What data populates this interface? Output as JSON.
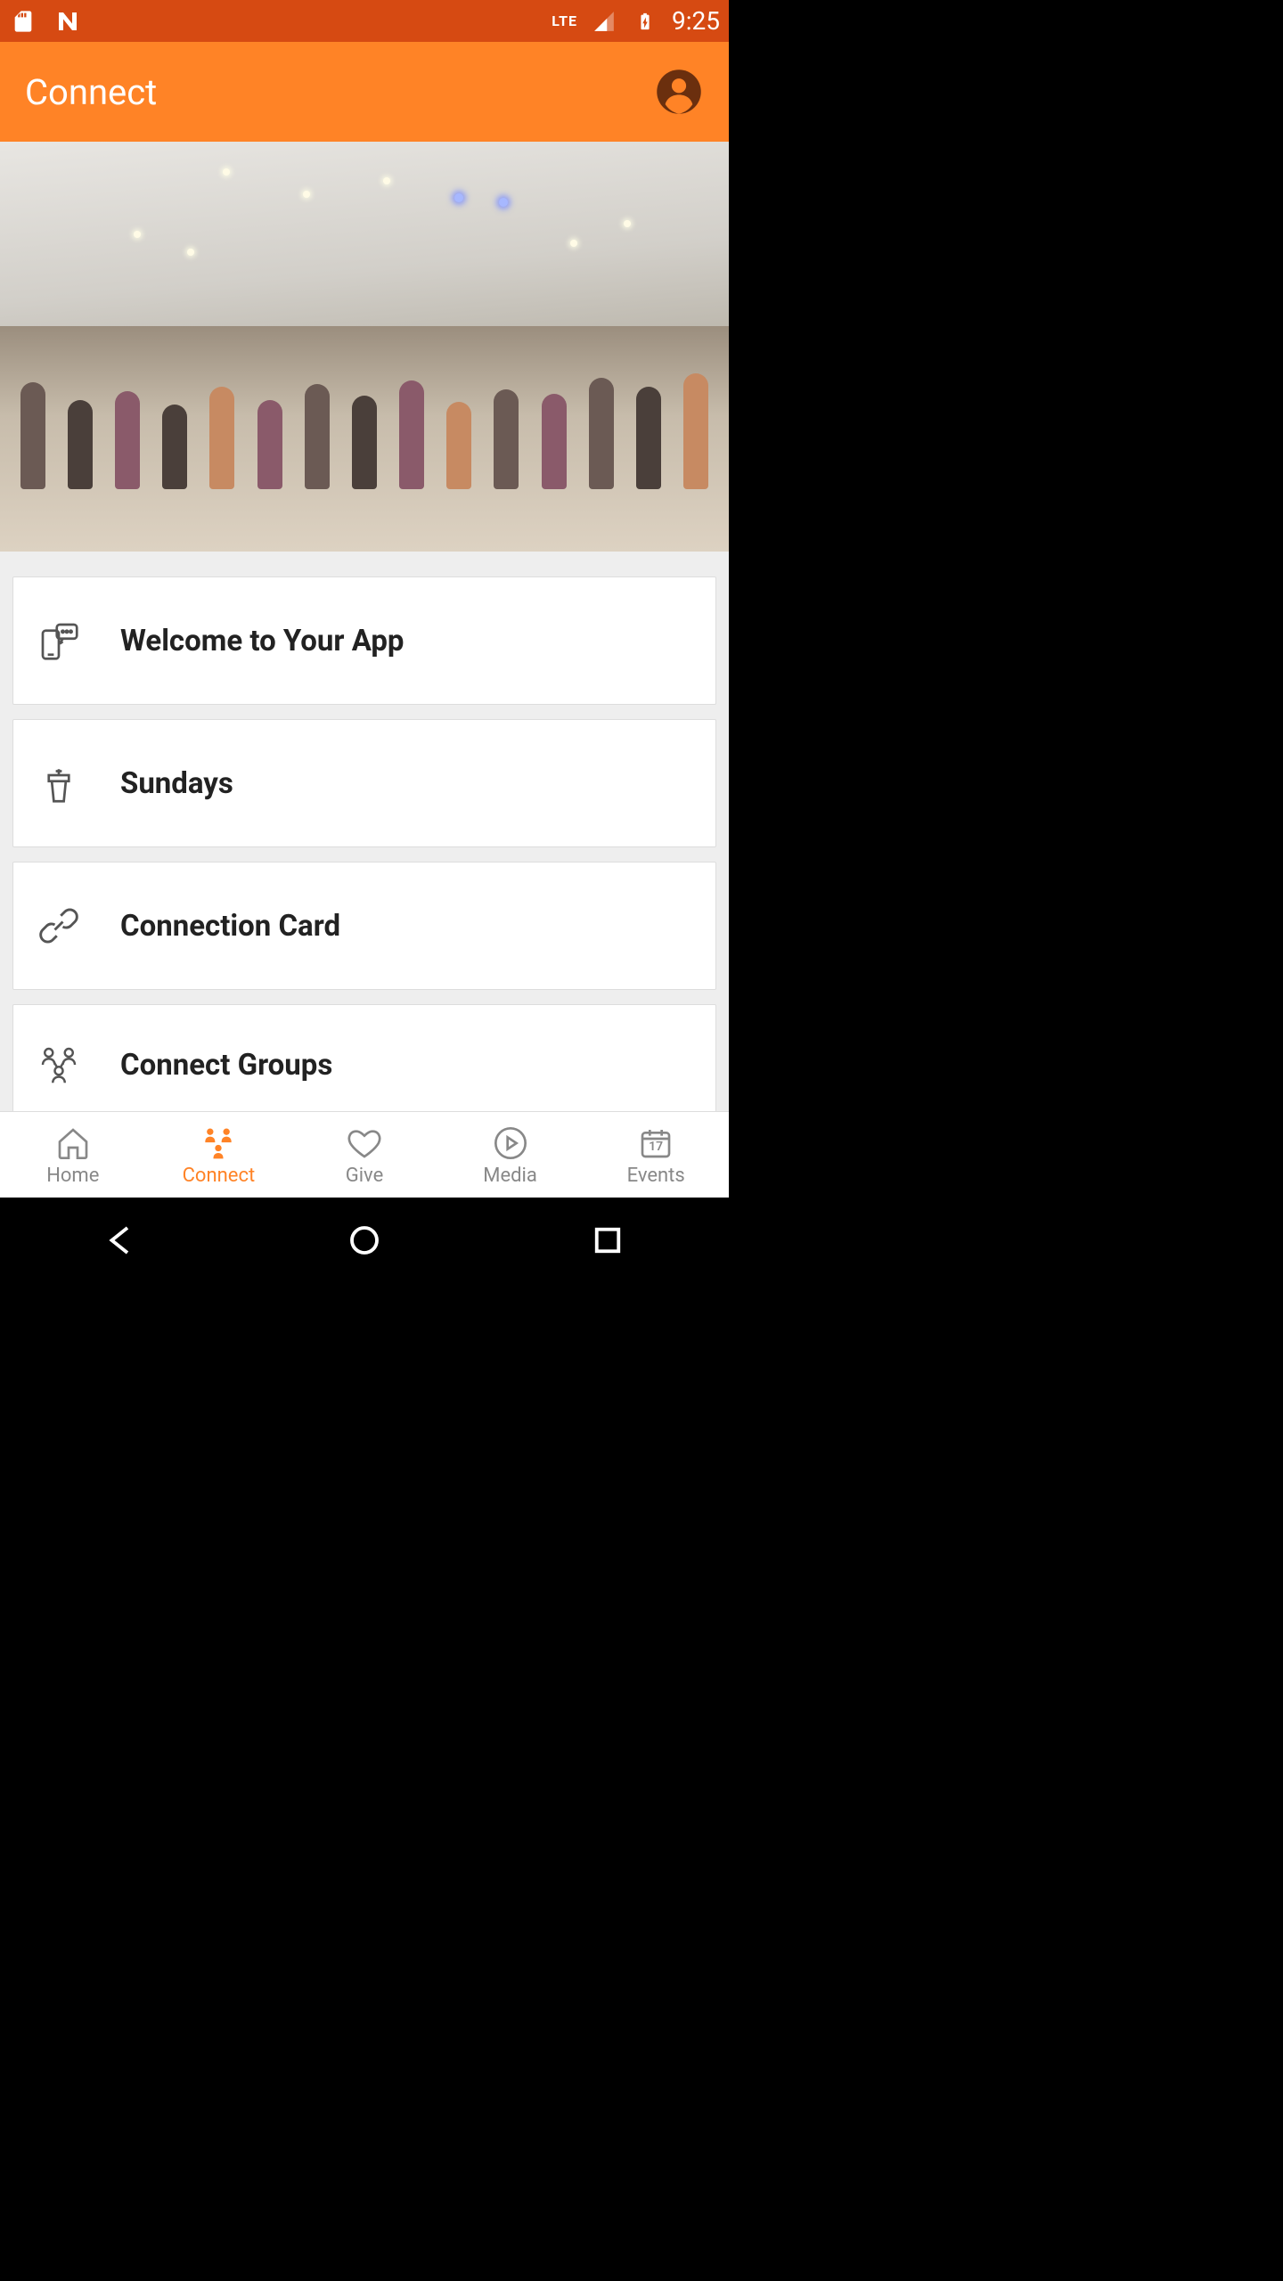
{
  "status": {
    "time": "9:25",
    "lte": "LTE"
  },
  "header": {
    "title": "Connect"
  },
  "cards": [
    {
      "icon": "chat-phone-icon",
      "label": "Welcome to Your App"
    },
    {
      "icon": "podium-icon",
      "label": "Sundays"
    },
    {
      "icon": "link-icon",
      "label": "Connection Card"
    },
    {
      "icon": "people-icon",
      "label": "Connect Groups"
    }
  ],
  "tabs": [
    {
      "key": "home",
      "label": "Home",
      "active": false
    },
    {
      "key": "connect",
      "label": "Connect",
      "active": true
    },
    {
      "key": "give",
      "label": "Give",
      "active": false
    },
    {
      "key": "media",
      "label": "Media",
      "active": false
    },
    {
      "key": "events",
      "label": "Events",
      "active": false,
      "badge": "17"
    }
  ]
}
